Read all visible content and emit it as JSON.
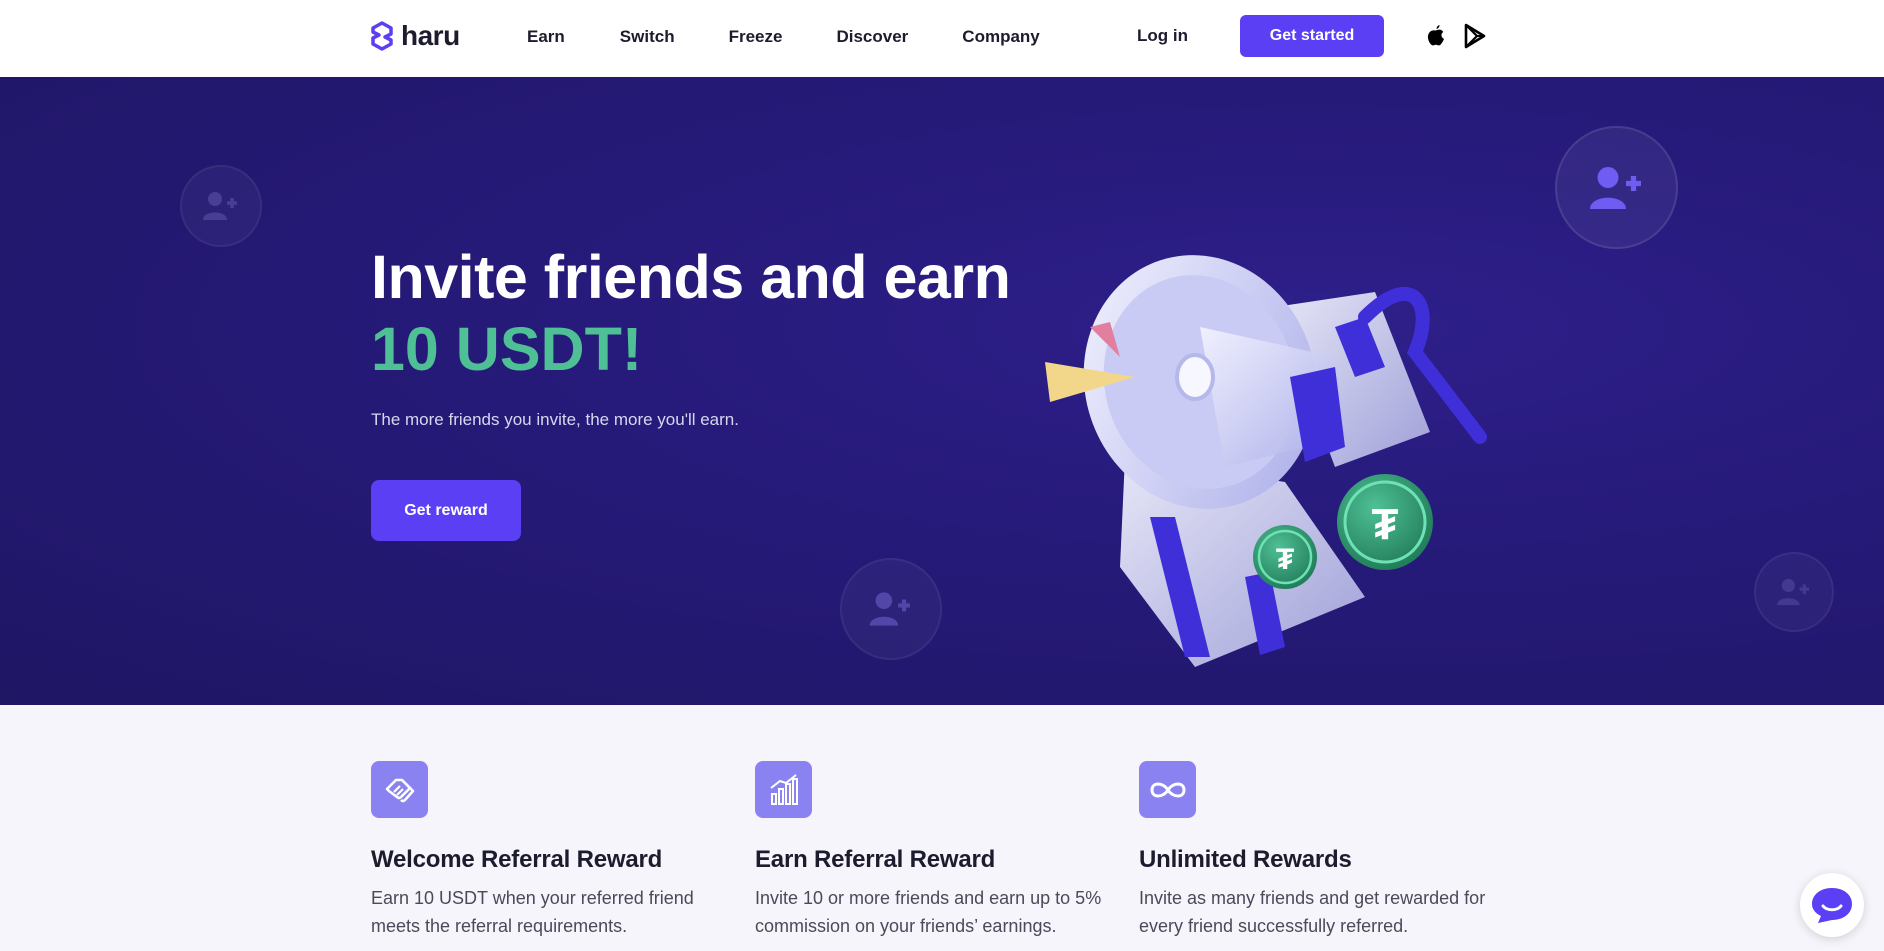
{
  "header": {
    "logo_text": "haru",
    "nav": [
      "Earn",
      "Switch",
      "Freeze",
      "Discover",
      "Company"
    ],
    "login_label": "Log in",
    "get_started_label": "Get started",
    "store_icons": [
      "apple-icon",
      "google-play-icon"
    ]
  },
  "hero": {
    "title": "Invite friends and earn",
    "highlight": "10 USDT!",
    "subtitle": "The more friends you invite, the more you'll earn.",
    "cta_label": "Get reward",
    "highlight_color": "#4fc095",
    "background_color": "#261a7a"
  },
  "features": [
    {
      "icon": "handshake-icon",
      "title": "Welcome Referral Reward",
      "description_lines": [
        "Earn 10 USDT when your referred friend",
        "meets the referral requirements."
      ]
    },
    {
      "icon": "bar-chart-icon",
      "title": "Earn Referral Reward",
      "description_lines": [
        "Invite 10 or more friends and earn up to 5%",
        "commission on your friends’ earnings."
      ]
    },
    {
      "icon": "infinity-icon",
      "title": "Unlimited Rewards",
      "description_lines": [
        "Invite as many friends and get rewarded for",
        "every friend successfully referred."
      ]
    }
  ],
  "colors": {
    "accent": "#5a3ff5",
    "feature_icon_bg": "#8b82f2"
  }
}
